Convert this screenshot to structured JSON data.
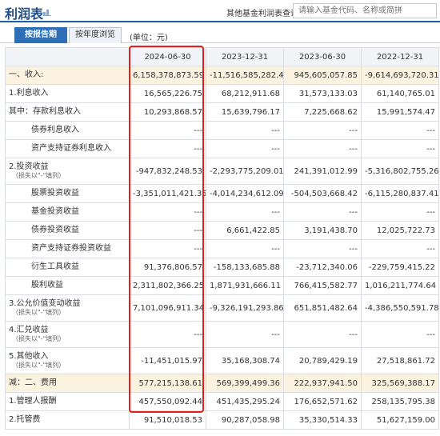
{
  "header": {
    "title": "利润表",
    "query_label": "其他基金利润表查询：",
    "query_placeholder": "请输入基金代码、名称或简拼"
  },
  "tabs": [
    {
      "label": "按报告期",
      "active": true
    },
    {
      "label": "按年度浏览",
      "active": false
    }
  ],
  "unit_label": "(单位：元)",
  "table": {
    "columns": [
      "2024-06-30",
      "2023-12-31",
      "2023-06-30",
      "2022-12-31"
    ],
    "rows": [
      {
        "label": "一、收入:",
        "values": [
          "6,158,378,873.59",
          "-11,516,585,282.45",
          "945,605,057.85",
          "-9,614,693,720.31"
        ]
      },
      {
        "label": "1.利息收入",
        "values": [
          "16,565,226.75",
          "68,212,911.68",
          "31,573,133.03",
          "61,140,765.01"
        ]
      },
      {
        "label": "其中：存款利息收入",
        "values": [
          "10,293,868.57",
          "15,639,796.17",
          "7,225,668.62",
          "15,991,574.47"
        ]
      },
      {
        "label": "债券利息收入",
        "values": [
          "---",
          "---",
          "---",
          "---"
        ]
      },
      {
        "label": "资产支持证券利息收入",
        "values": [
          "---",
          "---",
          "---",
          "---"
        ]
      },
      {
        "label": "2.投资收益",
        "sub": "（损失以\"-\"填列）",
        "values": [
          "-947,832,248.53",
          "-2,293,775,209.01",
          "241,391,012.99",
          "-5,316,802,755.26"
        ]
      },
      {
        "label": "股票投资收益",
        "values": [
          "-3,351,011,421.35",
          "-4,014,234,612.09",
          "-504,503,668.42",
          "-6,115,280,837.41"
        ]
      },
      {
        "label": "基金投资收益",
        "values": [
          "---",
          "---",
          "---",
          "---"
        ]
      },
      {
        "label": "债券投资收益",
        "values": [
          "---",
          "6,661,422.85",
          "3,191,438.70",
          "12,025,722.73"
        ]
      },
      {
        "label": "资产支持证券投资收益",
        "values": [
          "---",
          "---",
          "---",
          "---"
        ]
      },
      {
        "label": "衍生工具收益",
        "values": [
          "91,376,806.57",
          "-158,133,685.88",
          "-23,712,340.06",
          "-229,759,415.22"
        ]
      },
      {
        "label": "股利收益",
        "values": [
          "2,311,802,366.25",
          "1,871,931,666.11",
          "766,415,582.77",
          "1,016,211,774.64"
        ]
      },
      {
        "label": "3.公允价值变动收益",
        "sub": "（损失以\"-\"填列）",
        "values": [
          "7,101,096,911.34",
          "-9,326,191,293.86",
          "651,851,482.64",
          "-4,386,550,591.78"
        ]
      },
      {
        "label": "4.汇兑收益",
        "sub": "（损失以\"-\"填列）",
        "values": [
          "---",
          "---",
          "---",
          "---"
        ]
      },
      {
        "label": "5.其他收入",
        "sub": "（损失以\"-\"填列）",
        "values": [
          "-11,451,015.97",
          "35,168,308.74",
          "20,789,429.19",
          "27,518,861.72"
        ]
      },
      {
        "label": "减：二、费用",
        "values": [
          "577,215,138.61",
          "569,399,499.36",
          "222,937,941.50",
          "325,569,388.17"
        ]
      },
      {
        "label": "1.管理人报酬",
        "values": [
          "457,550,092.44",
          "451,435,295.24",
          "176,652,571.62",
          "258,135,795.38"
        ]
      },
      {
        "label": "2.托管费",
        "values": [
          "91,510,018.53",
          "90,287,058.98",
          "35,330,514.33",
          "51,627,159.00"
        ]
      }
    ]
  },
  "colors": {
    "accent": "#1f5fa8",
    "tab_active": "#2e6fb7",
    "highlight_row": "#fbf3df",
    "marker": "#e02020"
  }
}
